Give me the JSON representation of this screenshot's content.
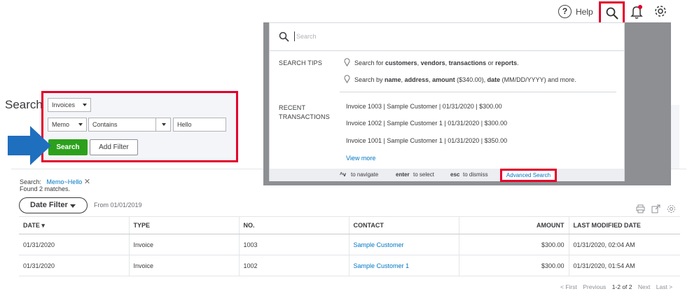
{
  "topbar": {
    "help_icon_glyph": "?",
    "help_label": "Help"
  },
  "page": {
    "title": "Search"
  },
  "filter": {
    "type_select": "Invoices",
    "field_select": "Memo",
    "operator_select": "Contains",
    "value_input": "Hello",
    "search_button": "Search",
    "add_filter_button": "Add Filter"
  },
  "results": {
    "search_label": "Search:",
    "search_term": "Memo~Hello",
    "found_text": "Found 2 matches.",
    "date_filter_button": "Date Filter",
    "from_text": "From 01/01/2019",
    "columns": {
      "date": "DATE ▾",
      "type": "TYPE",
      "no": "NO.",
      "contact": "CONTACT",
      "amount": "AMOUNT",
      "last_modified": "LAST MODIFIED DATE"
    },
    "rows": [
      {
        "date": "01/31/2020",
        "type": "Invoice",
        "no": "1003",
        "contact": "Sample Customer",
        "amount": "$300.00",
        "modified": "01/31/2020, 02:04 AM"
      },
      {
        "date": "01/31/2020",
        "type": "Invoice",
        "no": "1002",
        "contact": "Sample Customer 1",
        "amount": "$300.00",
        "modified": "01/31/2020, 01:54 AM"
      }
    ],
    "pager": {
      "first": "< First",
      "previous": "Previous",
      "range": "1-2 of 2",
      "next": "Next",
      "last": "Last >"
    }
  },
  "dropdown": {
    "search_placeholder": "Search",
    "search_tips_heading": "SEARCH TIPS",
    "tip1": {
      "pre": "Search for ",
      "b1": "customers",
      "s1": ", ",
      "b2": "vendors",
      "s2": ", ",
      "b3": "transactions",
      "s3": " or ",
      "b4": "reports",
      "post": "."
    },
    "tip2": {
      "pre": "Search by ",
      "b1": "name",
      "s1": ", ",
      "b2": "address",
      "s2": ", ",
      "b3": "amount",
      "s3": " ($340.00), ",
      "b4": "date",
      "post": " (MM/DD/YYYY) and more."
    },
    "recent_heading_1": "RECENT",
    "recent_heading_2": "TRANSACTIONS",
    "recent": [
      "Invoice 1003 | Sample Customer | 01/31/2020 | $300.00",
      "Invoice 1002 | Sample Customer 1 | 01/31/2020 | $300.00",
      "Invoice 1001 | Sample Customer 1 | 01/31/2020 | $350.00"
    ],
    "view_more": "View more",
    "footer": {
      "nav_key": "^v",
      "nav_text": "to navigate",
      "enter_key": "enter",
      "enter_text": "to select",
      "esc_key": "esc",
      "esc_text": "to dismiss",
      "advanced_search": "Advanced Search"
    }
  },
  "colors": {
    "highlight_red": "#e4002b",
    "search_green": "#2ca01c",
    "link_blue": "#0077c5",
    "arrow_blue": "#1f6fbf"
  },
  "icons": [
    "help-icon",
    "search-icon",
    "bell-icon",
    "gear-icon",
    "remove-icon",
    "print-icon",
    "export-icon",
    "settings-icon",
    "pin-icon"
  ]
}
